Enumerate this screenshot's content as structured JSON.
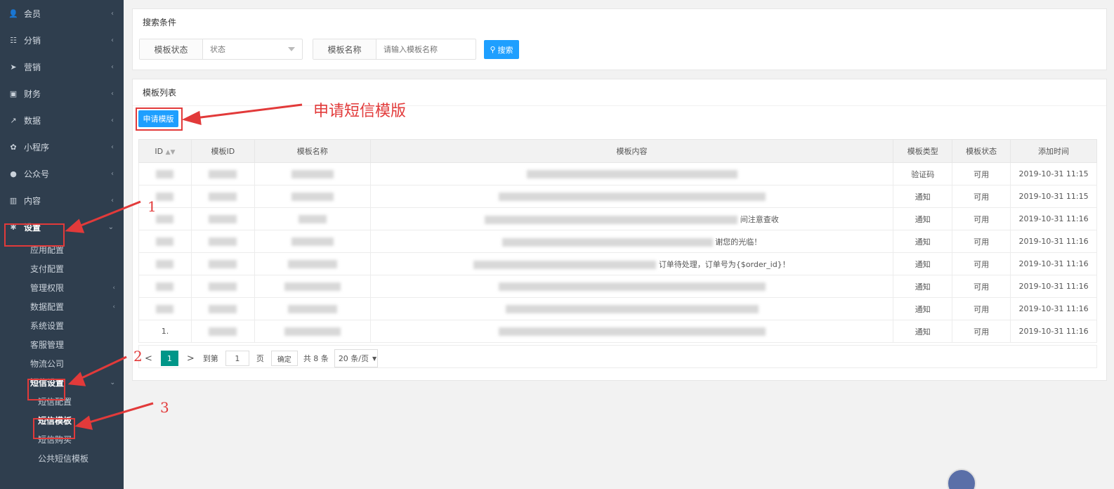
{
  "sidebar": {
    "items": [
      {
        "label": "会员",
        "icon": "user-icon"
      },
      {
        "label": "分销",
        "icon": "sitemap-icon"
      },
      {
        "label": "营销",
        "icon": "send-icon"
      },
      {
        "label": "财务",
        "icon": "money-icon"
      },
      {
        "label": "数据",
        "icon": "chart-icon"
      },
      {
        "label": "小程序",
        "icon": "miniapp-icon"
      },
      {
        "label": "公众号",
        "icon": "wechat-icon"
      },
      {
        "label": "内容",
        "icon": "book-icon"
      }
    ],
    "settings": {
      "label": "设置",
      "icon": "gear-icon"
    },
    "settings_children": [
      "应用配置",
      "支付配置",
      "管理权限",
      "数据配置",
      "系统设置",
      "客服管理",
      "物流公司"
    ],
    "sms": {
      "label": "短信设置"
    },
    "sms_children": [
      "短信配置",
      "短信模板",
      "短信购买",
      "公共短信模板"
    ]
  },
  "search": {
    "title": "搜索条件",
    "status_label": "模板状态",
    "status_value": "状态",
    "name_label": "模板名称",
    "name_placeholder": "请输入模板名称",
    "search_button": "搜索"
  },
  "list": {
    "title": "模板列表",
    "apply_button": "申请模版",
    "columns": [
      "ID",
      "模板ID",
      "模板名称",
      "模板内容",
      "模板类型",
      "模板状态",
      "添加时间"
    ],
    "rows": [
      {
        "id": "",
        "type": "验证码",
        "status": "可用",
        "time": "2019-10-31 11:15",
        "content_tail": ""
      },
      {
        "id": "",
        "type": "通知",
        "status": "可用",
        "time": "2019-10-31 11:15",
        "content_tail": ""
      },
      {
        "id": "",
        "type": "通知",
        "status": "可用",
        "time": "2019-10-31 11:16",
        "content_tail": "间注意查收"
      },
      {
        "id": "",
        "type": "通知",
        "status": "可用",
        "time": "2019-10-31 11:16",
        "content_tail": "谢您的光临！"
      },
      {
        "id": "",
        "type": "通知",
        "status": "可用",
        "time": "2019-10-31 11:16",
        "content_tail": "订单待处理，订单号为{$order_id}！"
      },
      {
        "id": "",
        "type": "通知",
        "status": "可用",
        "time": "2019-10-31 11:16",
        "content_tail": ""
      },
      {
        "id": "",
        "type": "通知",
        "status": "可用",
        "time": "2019-10-31 11:16",
        "content_tail": ""
      },
      {
        "id": "1.",
        "type": "通知",
        "status": "可用",
        "time": "2019-10-31 11:16",
        "content_tail": ""
      }
    ]
  },
  "pager": {
    "prev": "<",
    "page": "1",
    "next": ">",
    "goto_label": "到第",
    "goto_value": "1",
    "page_unit": "页",
    "confirm": "确定",
    "total": "共 8 条",
    "per_page": "20 条/页"
  },
  "annotations": {
    "apply_hint": "申请短信模版",
    "step1": "1",
    "step2": "2",
    "step3": "3"
  },
  "colors": {
    "sidebar_bg": "#2f3e4e",
    "accent_blue": "#1e9fff",
    "pager_active": "#009688",
    "annotation_red": "#e23a3a"
  }
}
